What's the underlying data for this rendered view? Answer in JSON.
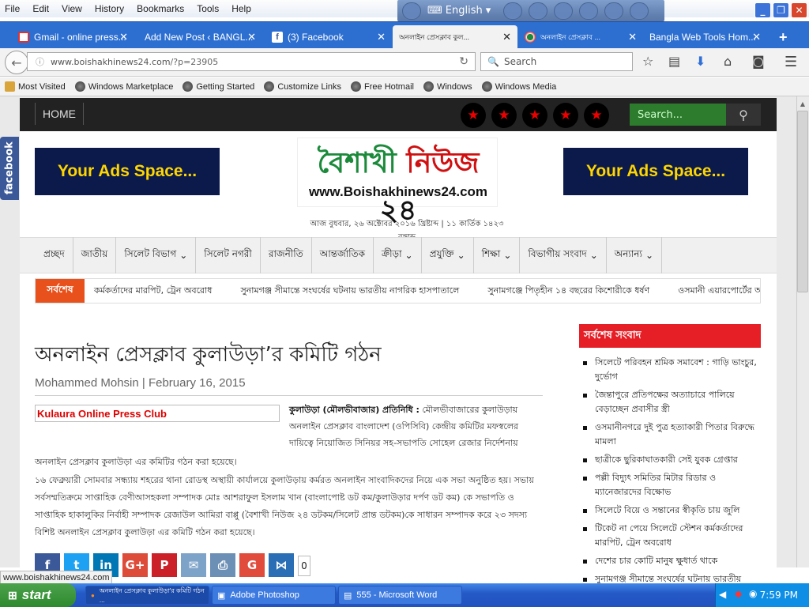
{
  "browser": {
    "menu": [
      "File",
      "Edit",
      "View",
      "History",
      "Bookmarks",
      "Tools",
      "Help"
    ],
    "language": "English",
    "tabs": [
      {
        "label": "Gmail - online press..."
      },
      {
        "label": "Add New Post ‹ BANGL..."
      },
      {
        "label": "(3) Facebook"
      },
      {
        "label": "অনলাইন প্রেসক্লাব কুল..."
      },
      {
        "label": "অনলাইন প্রেসক্লাব ..."
      },
      {
        "label": "Bangla Web Tools Hom..."
      }
    ],
    "url": "www.boishakhinews24.com/?p=23905",
    "url_host": "www.boishakhinews24.com",
    "url_path": "/?p=23905",
    "search_placeholder": "Search",
    "bookmarks": [
      "Most Visited",
      "Windows Marketplace",
      "Getting Started",
      "Customize Links",
      "Free Hotmail",
      "Windows",
      "Windows Media"
    ]
  },
  "site": {
    "facebook_tab": "facebook",
    "home": "HOME",
    "stars": [
      "★",
      "★",
      "★",
      "★",
      "★"
    ],
    "search_placeholder": "Search...",
    "ad_left": "Your Ads Space...",
    "ad_right": "Your Ads Space...",
    "logo_part1": "বৈশাখী",
    "logo_part2": "নিউজ",
    "logo_part3": "২৪",
    "logo_url": "www.Boishakhinews24.com",
    "dateline": "আজ বুধবার, ২৬ অক্টোবর ২০১৬ খ্রিষ্টাব্দ | ১১ কার্তিক ১৪২৩ বঙ্গাব্দ",
    "categories": [
      {
        "label": "প্রচ্ছদ",
        "dropdown": false
      },
      {
        "label": "জাতীয়",
        "dropdown": false
      },
      {
        "label": "সিলেট বিভাগ",
        "dropdown": true
      },
      {
        "label": "সিলেট নগরী",
        "dropdown": false
      },
      {
        "label": "রাজনীতি",
        "dropdown": false
      },
      {
        "label": "আন্তর্জাতিক",
        "dropdown": false
      },
      {
        "label": "ক্রীড়া",
        "dropdown": true
      },
      {
        "label": "প্রযুক্তি",
        "dropdown": true
      },
      {
        "label": "শিক্ষা",
        "dropdown": true
      },
      {
        "label": "বিভাগীয় সংবাদ",
        "dropdown": true
      },
      {
        "label": "অন্যান্য",
        "dropdown": true
      }
    ],
    "ticker_label": "সর্বশেষ",
    "ticker": [
      "কর্মকর্তাদের মারপিট, ট্রেন অবরোধ",
      "সুনামগঞ্জ সীমান্তে সংঘর্ষের ঘটনায় ভারতীয় নাগরিক হাসপাতালে",
      "সুনামগঞ্জে পিতৃহীন ১৪ বছরের কিশোরীকে ধর্ষণ",
      "ওসমানী এয়ারপোর্টের আ"
    ],
    "article": {
      "title": "অনলাইন প্রেসক্লাব কুলাউড়া’র কমিটি গঠন",
      "author": "Mohammed Mohsin",
      "date": "February 16, 2015",
      "image_caption": "Kulaura Online Press Club",
      "lead_bold": "কুলাউড়া (মৌলভীবাজার) প্রতিনিধি :",
      "lead_text": " মৌলভীবাজারের কুলাউড়ায় অনলাইন প্রেসক্লাব বাংলাদেশ (ওপিসিবি) কেন্দ্রীয় কমিটির মফস্বলের দায়িত্বে নিয়োজিত সিনিয়র সহ-সভাপতি সোহেল রেজার নির্দেশনায়",
      "lead_cont": "অনলাইন প্রেসক্লাব কুলাউড়া এর কমিটির গঠন করা হয়েছে।",
      "body": "১৬ ফেব্রুয়ারী সোমবার সন্ধ্যায় শহরের থানা রোডস্থ অস্থায়ী কার্যালয়ে কুলাউড়ায় কর্মরত অনলাইন সাংবাদিকদের নিয়ে এক সভা অনুষ্ঠিত হয়। সভায় সর্বসম্মতিক্রমে সাপ্তাহিক বেণীআসহকলা সম্পাদক মোঃ আশরাফুল ইসলাম খান (বাংলাপোষ্ট ডট কম/কুলাউড়ার দর্পণ ডট কম) কে সভাপতি ও সাপ্তাহিক হাকালুকির নির্বাহী সম্পাদক রেজাউল আমিরা বাপ্পু (বৈশাখী নিউজ ২৪ ডটকম/সিলেট প্রান্ত ডটকম)কে সাধারন সম্পাদক করে ২৩ সদস্য বিশিষ্ট অনলাইন প্রেসক্লাব কুলাউড়া এর কমিটি গঠন করা হয়েছে।",
      "share": [
        {
          "glyph": "f",
          "color": "#3b5998"
        },
        {
          "glyph": "t",
          "color": "#1da1f2"
        },
        {
          "glyph": "in",
          "color": "#0077b5"
        },
        {
          "glyph": "G+",
          "color": "#dd4b39"
        },
        {
          "glyph": "P",
          "color": "#cb2027"
        },
        {
          "glyph": "✉",
          "color": "#7ea3c9"
        },
        {
          "glyph": "⎙",
          "color": "#6c8fb5"
        },
        {
          "glyph": "G",
          "color": "#e04b3c"
        },
        {
          "glyph": "⋈",
          "color": "#2a6fb5"
        }
      ],
      "share_count": "0"
    },
    "sidebar_title": "সর্বশেষ সংবাদ",
    "sidebar": [
      "সিলেটে পরিবহন শ্রমিক সমাবেশ : গাড়ি ভাংচুর, দুর্ভোগ",
      "জৈন্তাপুরে প্রতিপক্ষের অত্যাচারে পালিয়ে বেড়াচ্ছেন প্রবাসীর স্ত্রী",
      "ওসমানীনগরে দুই পুত্র হত্যাকারী পিতার বিরুদ্ধে মামলা",
      "ছাত্রীকে ছুরিকাঘাতকারী সেই যুবক গ্রেপ্তার",
      "পল্লী বিদ্যুৎ সমিতির মিটার রিডার ও ম্যানেজারদের বিক্ষোভ",
      "সিলেটে বিয়ে ও সন্তানের স্বীকৃতি চায় জুলি",
      "টিকেট না পেয়ে সিলেটে স্টেশন কর্মকর্তাদের মারপিট, ট্রেন অবরোধ",
      "দেশের চার কোটি মানুষ ক্ষুধার্ত থাকে",
      "সুনামগঞ্জ সীমান্তে সংঘর্ষের ঘটনায় ভারতীয়"
    ]
  },
  "status_url": "www.boishakhinews24.com",
  "taskbar": {
    "start": "start",
    "items": [
      {
        "label": "অনলাইন প্রেসক্লাব কুলাউড়া'র কমিটি গঠন ..."
      },
      {
        "label": "Adobe Photoshop"
      },
      {
        "label": "555 - Microsoft Word"
      }
    ],
    "time": "7:59 PM"
  }
}
